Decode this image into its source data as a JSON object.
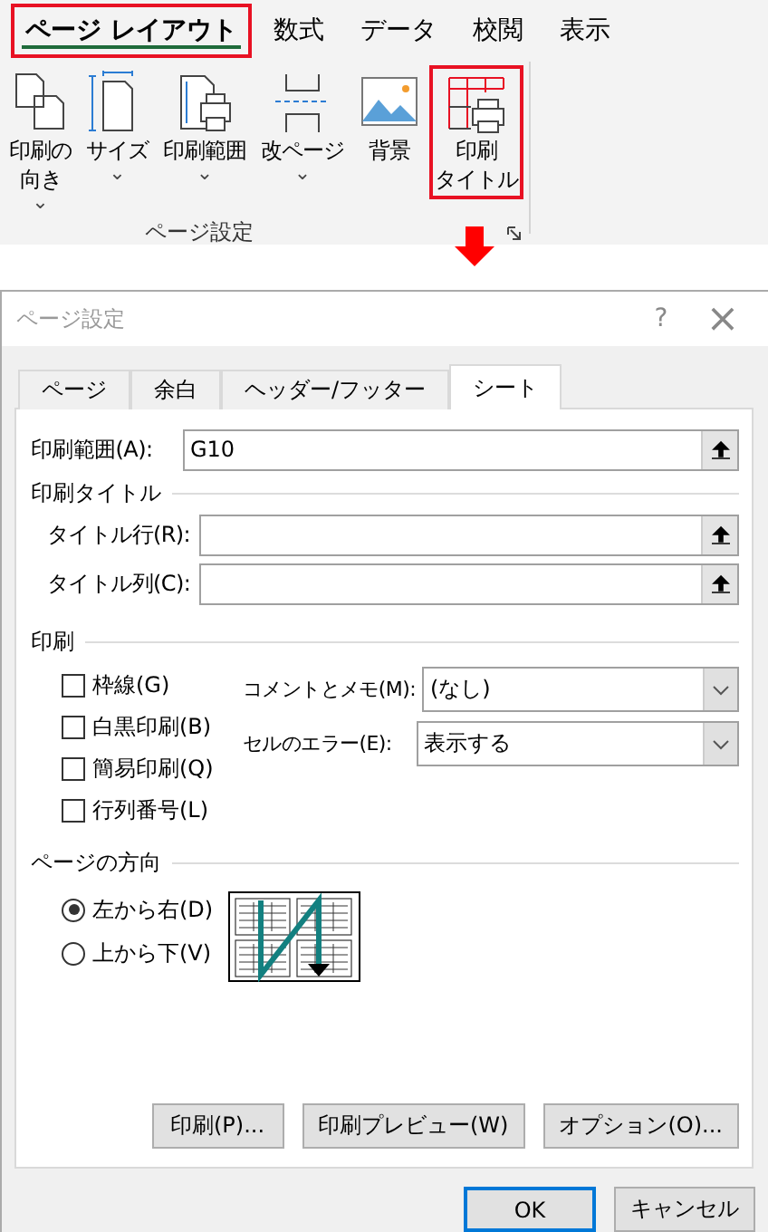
{
  "ribbon": {
    "tabs": [
      {
        "label": "ページ レイアウト",
        "selected": true,
        "highlighted": true
      },
      {
        "label": "数式",
        "selected": false,
        "highlighted": false
      },
      {
        "label": "データ",
        "selected": false,
        "highlighted": false
      },
      {
        "label": "校閲",
        "selected": false,
        "highlighted": false
      },
      {
        "label": "表示",
        "selected": false,
        "highlighted": false
      }
    ],
    "buttons": [
      {
        "kind": "orientation",
        "lines": [
          "印刷の",
          "向き"
        ],
        "caret": "⌄",
        "highlighted": false
      },
      {
        "kind": "size",
        "lines": [
          "サイズ"
        ],
        "caret": "⌄",
        "highlighted": false
      },
      {
        "kind": "print-area",
        "lines": [
          "印刷範囲"
        ],
        "caret": "⌄",
        "highlighted": false
      },
      {
        "kind": "breaks",
        "lines": [
          "改ページ"
        ],
        "caret": "⌄",
        "highlighted": false
      },
      {
        "kind": "background",
        "lines": [
          "背景"
        ],
        "highlighted": false
      },
      {
        "kind": "print-titles",
        "lines": [
          "印刷",
          "タイトル"
        ],
        "highlighted": true
      }
    ],
    "group_label": "ページ設定"
  },
  "dialog": {
    "title": "ページ設定",
    "help": "?",
    "close": "×",
    "tabs": [
      {
        "label": "ページ",
        "selected": false
      },
      {
        "label": "余白",
        "selected": false
      },
      {
        "label": "ヘッダー/フッター",
        "selected": false
      },
      {
        "label": "シート",
        "selected": true
      }
    ],
    "print_area": {
      "label": "印刷範囲(A):",
      "value": "G10"
    },
    "print_titles": {
      "heading": "印刷タイトル",
      "fields": [
        {
          "label": "タイトル行(R):"
        },
        {
          "label": "タイトル列(C):"
        }
      ]
    },
    "print": {
      "heading": "印刷",
      "checkboxes": [
        {
          "label": "枠線(G)",
          "checked": false
        },
        {
          "label": "白黒印刷(B)",
          "checked": false
        },
        {
          "label": "簡易印刷(Q)",
          "checked": false
        },
        {
          "label": "行列番号(L)",
          "checked": false
        }
      ],
      "dropdowns": [
        {
          "label": "コメントとメモ(M):",
          "value": "(なし)"
        },
        {
          "label": "セルのエラー(E):",
          "value": "表示する"
        }
      ]
    },
    "page_order": {
      "heading": "ページの方向",
      "options": [
        {
          "label": "左から右(D)",
          "selected": true
        },
        {
          "label": "上から下(V)",
          "selected": false
        }
      ]
    },
    "actions": [
      "印刷(P)...",
      "印刷プレビュー(W)",
      "オプション(O)..."
    ],
    "footer": [
      {
        "label": "OK",
        "default": true
      },
      {
        "label": "キャンセル",
        "default": false
      }
    ]
  }
}
